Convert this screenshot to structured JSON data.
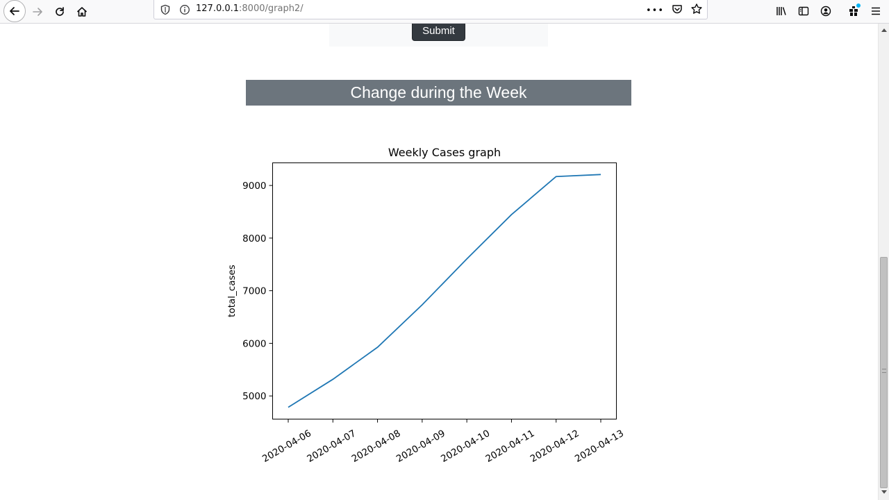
{
  "browser": {
    "url_host": "127.0.0.1",
    "url_path": ":8000/graph2/",
    "overflow_label": "•••"
  },
  "page": {
    "submit_label": "Submit",
    "section_title": "Change during the Week"
  },
  "chart_data": {
    "type": "line",
    "title": "Weekly Cases graph",
    "xlabel": "",
    "ylabel": "total_cases",
    "categories": [
      "2020-04-06",
      "2020-04-07",
      "2020-04-08",
      "2020-04-09",
      "2020-04-10",
      "2020-04-11",
      "2020-04-12",
      "2020-04-13"
    ],
    "values": [
      4784,
      5316,
      5926,
      6733,
      7603,
      8446,
      9170,
      9208
    ],
    "yticks": [
      5000,
      6000,
      7000,
      8000,
      9000
    ],
    "ylim": [
      4560,
      9430
    ],
    "color": "#1f77b4",
    "grid": false
  }
}
